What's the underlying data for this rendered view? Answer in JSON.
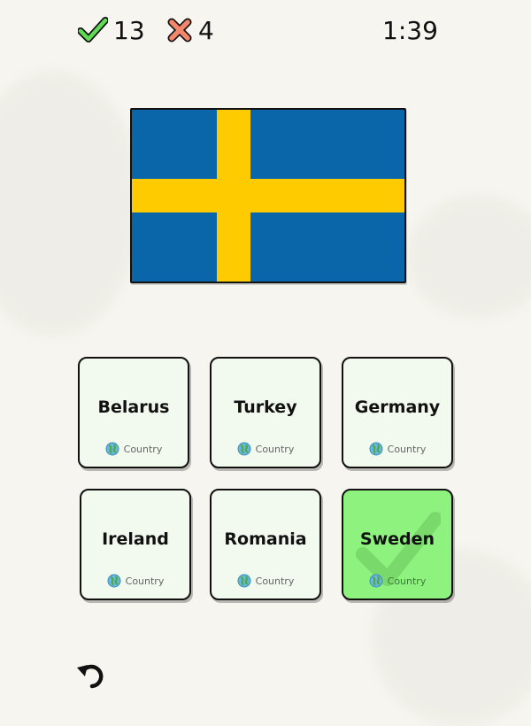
{
  "hud": {
    "correct_count": "13",
    "wrong_count": "4",
    "timer": "1:39"
  },
  "question": {
    "flag": "Sweden",
    "flag_colors": {
      "field": "#0a66a8",
      "cross": "#fecb00"
    }
  },
  "options": [
    {
      "label": "Belarus",
      "tag": "Country",
      "state": "default"
    },
    {
      "label": "Turkey",
      "tag": "Country",
      "state": "default"
    },
    {
      "label": "Germany",
      "tag": "Country",
      "state": "default"
    },
    {
      "label": "Ireland",
      "tag": "Country",
      "state": "default"
    },
    {
      "label": "Romania",
      "tag": "Country",
      "state": "default"
    },
    {
      "label": "Sweden",
      "tag": "Country",
      "state": "correct"
    }
  ],
  "colors": {
    "correct_green": "#5fdc55",
    "wrong_red": "#f3876b",
    "card_bg": "#f2f9ee",
    "card_correct_bg": "#8ef27e"
  },
  "controls": {
    "undo_icon": "undo-icon"
  }
}
